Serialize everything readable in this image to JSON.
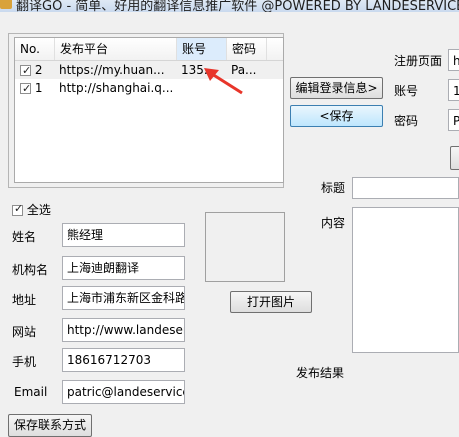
{
  "window": {
    "title": "翻译GO - 简单、好用的翻译信息推广软件 @POWERED BY LANDESERVICE"
  },
  "account_list": {
    "columns": [
      "No.",
      "发布平台",
      "账号",
      "密码"
    ],
    "rows": [
      {
        "checked": true,
        "no": "2",
        "platform": "https://my.huan...",
        "account": "135...",
        "password": "Pa..."
      },
      {
        "checked": true,
        "no": "1",
        "platform": "http://shanghai.q...",
        "account": "",
        "password": ""
      }
    ]
  },
  "buttons": {
    "edit_login": "编辑登录信息>",
    "save_left": "<保存",
    "open_image": "打开图片",
    "save_contact": "保存联系方式"
  },
  "login_panel": {
    "register_page_label": "注册页面",
    "register_page_value": "h",
    "account_label": "账号",
    "account_value": "1",
    "password_label": "密码",
    "password_value": "P"
  },
  "select_all": {
    "label": "全选",
    "checked": true
  },
  "contact": {
    "name_label": "姓名",
    "name_value": "熊经理",
    "org_label": "机构名",
    "org_value": "上海迪朗翻译",
    "address_label": "地址",
    "address_value": "上海市浦东新区金科路",
    "website_label": "网站",
    "website_value": "http://www.landeser",
    "phone_label": "手机",
    "phone_value": "18616712703",
    "email_label": "Email",
    "email_value": "patric@landeservice.c"
  },
  "post": {
    "title_label": "标题",
    "title_value": "",
    "content_label": "内容",
    "content_value": "",
    "result_label": "发布结果"
  },
  "colors": {
    "annotation_arrow": "#e8352a",
    "selection": "#dcecfc"
  }
}
